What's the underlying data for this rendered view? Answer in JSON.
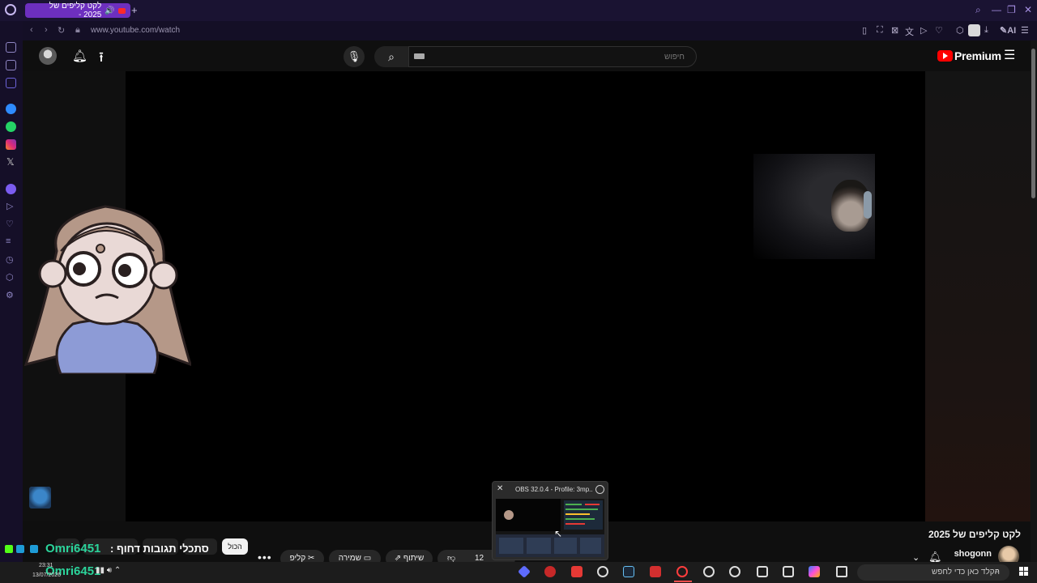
{
  "browser": {
    "tab_title": "לקט קליפים של 2025 -",
    "new_tab": "+",
    "address": "www.youtube.com/watch",
    "ext_ai_label": "AI",
    "colors": {
      "tab_active": "#6d2fbf",
      "chrome_bg": "#1a1332"
    }
  },
  "youtube": {
    "search_placeholder": "חיפוש",
    "premium_label": "Premium",
    "colors": {
      "logo_red": "#ff0000"
    }
  },
  "video": {
    "title": "לקט קליפים של 2025",
    "channel": "shogonn",
    "actions": {
      "likes": "12",
      "share": "שיתוף",
      "save": "שמירה",
      "clip": "קליפ",
      "more": "•••"
    },
    "chips": {
      "all": "הכול"
    }
  },
  "overlay": {
    "chat_name_1": "Omri6451",
    "chat_message": "סתכלי תגובות דחוף :",
    "chat_name_2": "Omri6451"
  },
  "obs_preview": {
    "title": "OBS 32.0.4 - Profile: 3mp..."
  },
  "taskbar": {
    "search_placeholder": "הקלד כאן כדי לחפש",
    "time": "23:31",
    "date": "13/07/2026"
  }
}
